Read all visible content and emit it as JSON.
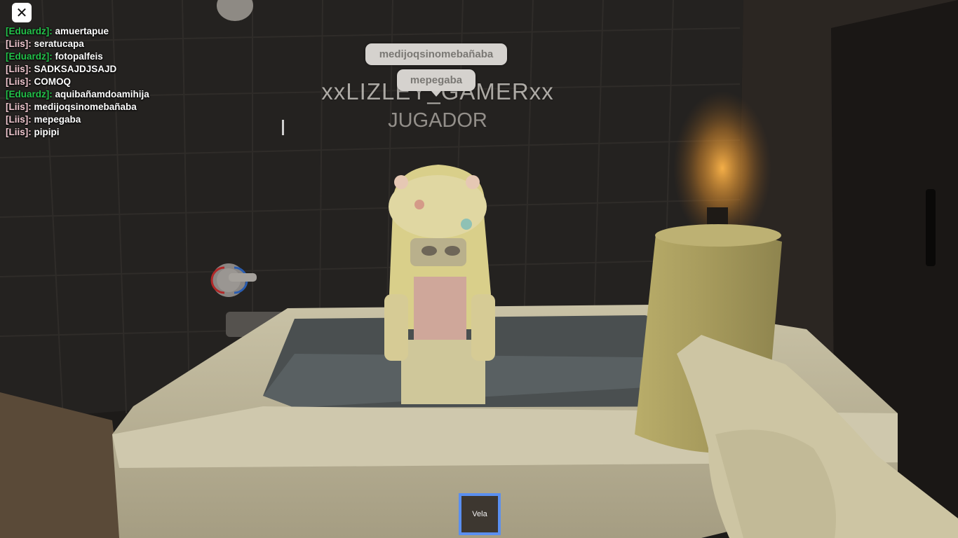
{
  "close_button": {
    "icon": "close-icon",
    "label": "✕"
  },
  "chat": {
    "messages": [
      {
        "speaker": "[Eduardz]:",
        "speaker_color": "#23c24a",
        "text": "amuertapue"
      },
      {
        "speaker": "[Liis]:",
        "speaker_color": "#f0c8d0",
        "text": "seratucapa"
      },
      {
        "speaker": "[Eduardz]:",
        "speaker_color": "#23c24a",
        "text": "fotopalfeis"
      },
      {
        "speaker": "[Liis]:",
        "speaker_color": "#f0c8d0",
        "text": "SADKSAJDJSAJD"
      },
      {
        "speaker": "[Liis]:",
        "speaker_color": "#f0c8d0",
        "text": "COMOQ"
      },
      {
        "speaker": "[Eduardz]:",
        "speaker_color": "#23c24a",
        "text": "aquibañamdoamihija"
      },
      {
        "speaker": "[Liis]:",
        "speaker_color": "#f0c8d0",
        "text": "medijoqsinomebañaba"
      },
      {
        "speaker": "[Liis]:",
        "speaker_color": "#f0c8d0",
        "text": "mepegaba"
      },
      {
        "speaker": "[Liis]:",
        "speaker_color": "#f0c8d0",
        "text": "pipipi"
      }
    ]
  },
  "bubbles": {
    "first": "medijoqsinomebañaba",
    "second": "mepegaba"
  },
  "player": {
    "name": "xxLIZLEY_GAMERxx",
    "role": "JUGADOR"
  },
  "hotbar": {
    "selected_item": "Vela",
    "accent": "#5a8ff0"
  }
}
